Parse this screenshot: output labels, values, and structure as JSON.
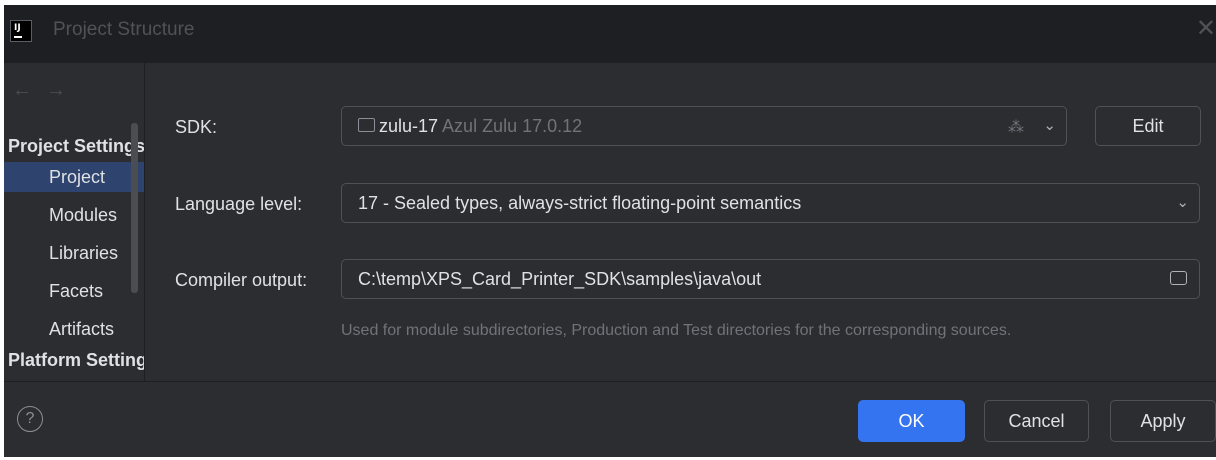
{
  "window": {
    "title": "Project Structure",
    "logo_text": "IJ"
  },
  "sidebar": {
    "sections": [
      {
        "label": "Project Settings"
      },
      {
        "label": "Platform Settings"
      }
    ],
    "items": [
      {
        "label": "Project",
        "selected": true
      },
      {
        "label": "Modules"
      },
      {
        "label": "Libraries"
      },
      {
        "label": "Facets"
      },
      {
        "label": "Artifacts"
      }
    ]
  },
  "sdk": {
    "label": "SDK:",
    "name": "zulu-17",
    "version": "Azul Zulu 17.0.12",
    "edit_label": "Edit"
  },
  "language_level": {
    "label": "Language level:",
    "value": "17 - Sealed types, always-strict floating-point semantics"
  },
  "compiler_output": {
    "label": "Compiler output:",
    "value": "C:\\temp\\XPS_Card_Printer_SDK\\samples\\java\\out",
    "hint": "Used for module subdirectories, Production and Test directories for the corresponding sources."
  },
  "footer": {
    "help": "?",
    "ok_label": "OK",
    "cancel_label": "Cancel",
    "apply_label": "Apply"
  },
  "colors": {
    "accent": "#3574f0",
    "background": "#2b2d30",
    "selection": "#2e436e"
  },
  "icons": [
    "app-logo-icon",
    "close-icon",
    "back-arrow-icon",
    "forward-arrow-icon",
    "folder-icon",
    "loading-spinner-icon",
    "chevron-down-icon",
    "help-icon"
  ]
}
